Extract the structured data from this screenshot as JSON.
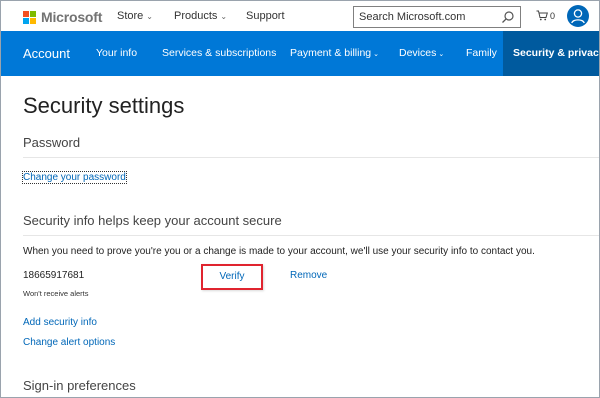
{
  "header": {
    "logo_text": "Microsoft",
    "nav": [
      {
        "label": "Store",
        "has_dropdown": true
      },
      {
        "label": "Products",
        "has_dropdown": true
      },
      {
        "label": "Support",
        "has_dropdown": false
      }
    ],
    "search_placeholder": "Search Microsoft.com",
    "cart_count": "0",
    "icons": {
      "search": "search-icon",
      "cart": "cart-icon",
      "avatar": "user-avatar-icon"
    }
  },
  "account_nav": {
    "brand": "Account",
    "items": [
      {
        "label": "Your info",
        "has_dropdown": false
      },
      {
        "label": "Services & subscriptions",
        "has_dropdown": false
      },
      {
        "label": "Payment & billing",
        "has_dropdown": true
      },
      {
        "label": "Devices",
        "has_dropdown": true
      },
      {
        "label": "Family",
        "has_dropdown": false
      },
      {
        "label": "Security & privacy",
        "has_dropdown": false,
        "active": true
      }
    ]
  },
  "main": {
    "title": "Security settings",
    "password": {
      "heading": "Password",
      "change_link": "Change your password"
    },
    "security_info": {
      "heading": "Security info helps keep your account secure",
      "description": "When you need to prove you're you or a change is made to your account, we'll use your security info to contact you.",
      "phone": "18665917681",
      "phone_note": "Won't receive alerts",
      "verify_label": "Verify",
      "remove_label": "Remove",
      "add_link": "Add security info",
      "alert_link": "Change alert options"
    },
    "signin": {
      "heading": "Sign-in preferences"
    }
  },
  "colors": {
    "accent": "#0078d7",
    "active_tab": "#005a9e",
    "link": "#0067b8",
    "highlight_box": "#e0242f",
    "ms_logo": [
      "#f25022",
      "#7fba00",
      "#00a4ef",
      "#ffb900"
    ]
  }
}
